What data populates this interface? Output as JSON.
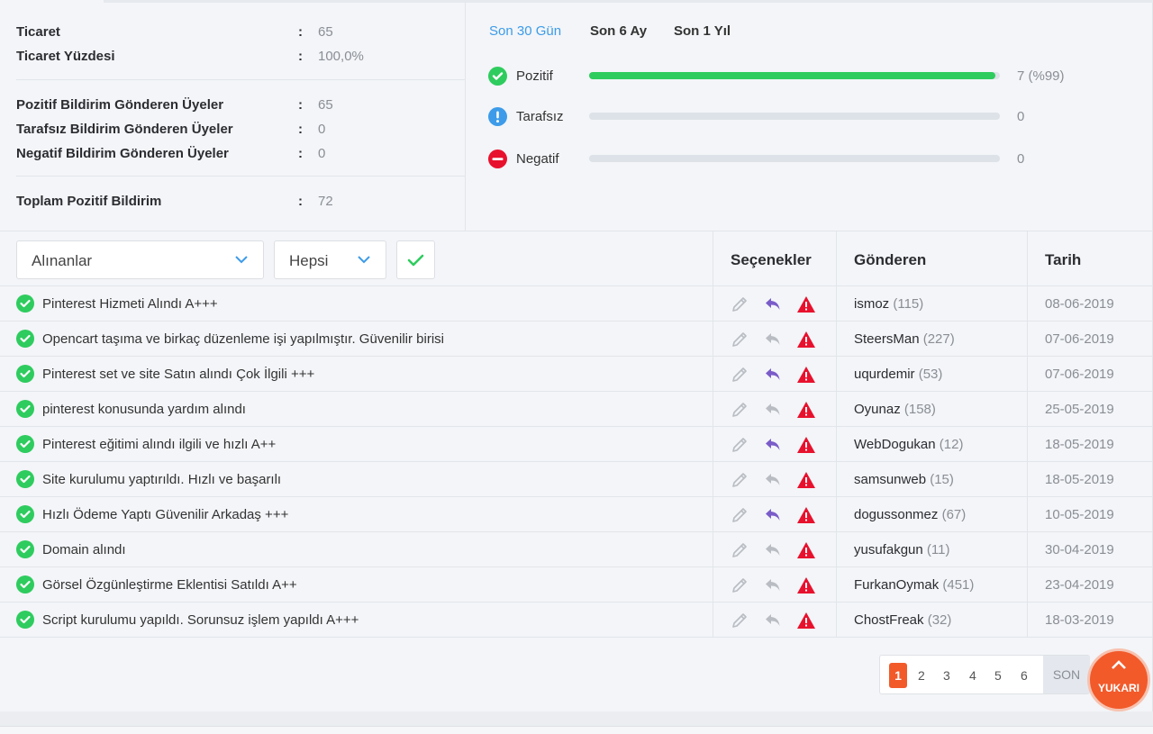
{
  "stats": {
    "trade_label": "Ticaret",
    "trade_value": "65",
    "trade_pct_label": "Ticaret Yüzdesi",
    "trade_pct_value": "100,0%",
    "pos_members_label": "Pozitif Bildirim Gönderen Üyeler",
    "pos_members_value": "65",
    "neu_members_label": "Tarafsız Bildirim Gönderen Üyeler",
    "neu_members_value": "0",
    "neg_members_label": "Negatif Bildirim Gönderen Üyeler",
    "neg_members_value": "0",
    "total_pos_label": "Toplam Pozitif Bildirim",
    "total_pos_value": "72",
    "colon": ":"
  },
  "periods": [
    "Son 30 Gün",
    "Son 6 Ay",
    "Son 1 Yıl"
  ],
  "ratings": {
    "positive": {
      "label": "Pozitif",
      "count": "7 (%99)",
      "fill_pct": 99,
      "color": "#2ecc5e"
    },
    "neutral": {
      "label": "Tarafsız",
      "count": "0",
      "fill_pct": 0,
      "color": "#3d9be9"
    },
    "negative": {
      "label": "Negatif",
      "count": "0",
      "fill_pct": 0,
      "color": "#e8112d"
    }
  },
  "filters": {
    "type_selected": "Alınanlar",
    "scope_selected": "Hepsi"
  },
  "columns": {
    "options": "Seçenekler",
    "sender": "Gönderen",
    "date": "Tarih"
  },
  "rows": [
    {
      "title": "Pinterest Hizmeti Alındı A+++",
      "sender": "ismoz",
      "count": "(115)",
      "date": "08-06-2019",
      "reply_active": true
    },
    {
      "title": "Opencart taşıma ve birkaç düzenleme işi yapılmıştır. Güvenilir birisi",
      "sender": "SteersMan",
      "count": "(227)",
      "date": "07-06-2019",
      "reply_active": false
    },
    {
      "title": "Pinterest set ve site Satın alındı Çok İlgili +++",
      "sender": "uqurdemir",
      "count": "(53)",
      "date": "07-06-2019",
      "reply_active": true
    },
    {
      "title": "pinterest konusunda yardım alındı",
      "sender": "Oyunaz",
      "count": "(158)",
      "date": "25-05-2019",
      "reply_active": false
    },
    {
      "title": "Pinterest eğitimi alındı ilgili ve hızlı A++",
      "sender": "WebDogukan",
      "count": "(12)",
      "date": "18-05-2019",
      "reply_active": true
    },
    {
      "title": "Site kurulumu yaptırıldı. Hızlı ve başarılı",
      "sender": "samsunweb",
      "count": "(15)",
      "date": "18-05-2019",
      "reply_active": false
    },
    {
      "title": "Hızlı Ödeme Yaptı Güvenilir Arkadaş +++",
      "sender": "dogussonmez",
      "count": "(67)",
      "date": "10-05-2019",
      "reply_active": true
    },
    {
      "title": "Domain alındı",
      "sender": "yusufakgun",
      "count": "(11)",
      "date": "30-04-2019",
      "reply_active": false
    },
    {
      "title": "Görsel Özgünleştirme Eklentisi Satıldı A++",
      "sender": "FurkanOymak",
      "count": "(451)",
      "date": "23-04-2019",
      "reply_active": false
    },
    {
      "title": "Script kurulumu yapıldı. Sorunsuz işlem yapıldı A+++",
      "sender": "ChostFreak",
      "count": "(32)",
      "date": "18-03-2019",
      "reply_active": false
    }
  ],
  "pagination": {
    "pages": [
      "1",
      "2",
      "3",
      "4",
      "5",
      "6"
    ],
    "current": "1",
    "last_label": "SON"
  },
  "scroll_top": {
    "label": "YUKARI"
  },
  "icons": {
    "check": "check-circle-icon",
    "edit": "pencil-icon",
    "reply": "reply-icon",
    "report": "warning-triangle-icon"
  },
  "colors": {
    "accent_blue": "#3d9be9",
    "positive": "#2ecc5e",
    "negative": "#e8112d",
    "orange": "#f25a2a",
    "reply_purple": "#7a5cc9"
  }
}
